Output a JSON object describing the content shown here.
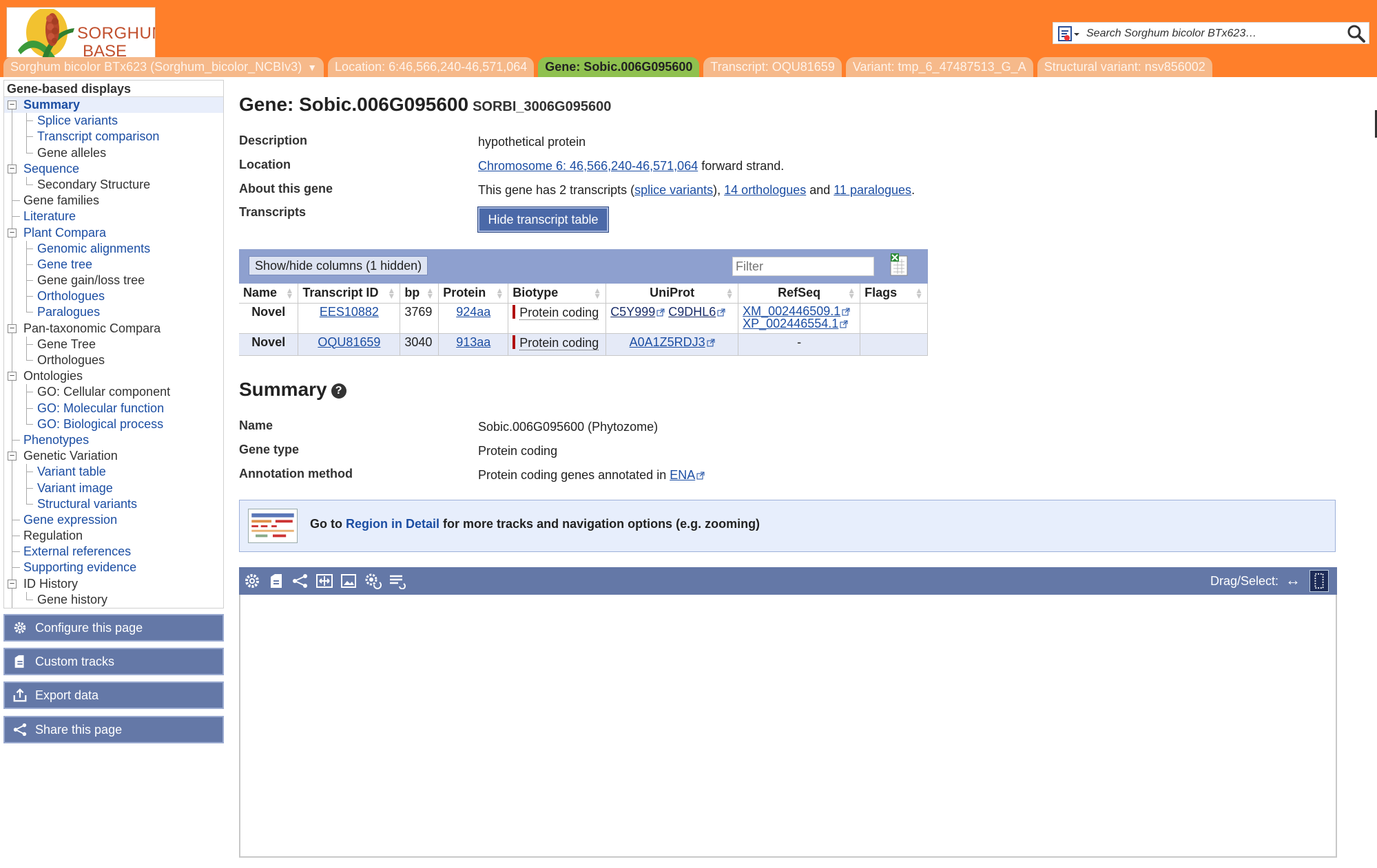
{
  "header": {
    "logo": {
      "line1": "SORGHUM",
      "line2": "BASE"
    },
    "search_placeholder": "Search Sorghum bicolor BTx623…",
    "tabs": [
      {
        "label": "Sorghum bicolor BTx623 (Sorghum_bicolor_NCBIv3)",
        "arrow": "▼"
      },
      {
        "label": "Location: 6:46,566,240-46,571,064"
      },
      {
        "label": "Gene: Sobic.006G095600",
        "active": true
      },
      {
        "label": "Transcript: OQU81659"
      },
      {
        "label": "Variant: tmp_6_47487513_G_A"
      },
      {
        "label": "Structural variant: nsv856002"
      }
    ]
  },
  "sidebar": {
    "heading": "Gene-based displays",
    "items": [
      {
        "label": "Summary",
        "level": 1,
        "box": "−",
        "link": true,
        "selected": true
      },
      {
        "label": "Splice variants",
        "level": 2,
        "link": true
      },
      {
        "label": "Transcript comparison",
        "level": 2,
        "link": true
      },
      {
        "label": "Gene alleles",
        "level": 2,
        "link": false
      },
      {
        "label": "Sequence",
        "level": 1,
        "box": "−",
        "link": true
      },
      {
        "label": "Secondary Structure",
        "level": 2,
        "link": false
      },
      {
        "label": "Gene families",
        "level": 1,
        "link": false
      },
      {
        "label": "Literature",
        "level": 1,
        "link": true
      },
      {
        "label": "Plant Compara",
        "level": 1,
        "box": "−",
        "link": true
      },
      {
        "label": "Genomic alignments",
        "level": 2,
        "link": true
      },
      {
        "label": "Gene tree",
        "level": 2,
        "link": true
      },
      {
        "label": "Gene gain/loss tree",
        "level": 2,
        "link": false
      },
      {
        "label": "Orthologues",
        "level": 2,
        "link": true
      },
      {
        "label": "Paralogues",
        "level": 2,
        "link": true
      },
      {
        "label": "Pan-taxonomic Compara",
        "level": 1,
        "box": "−",
        "link": false
      },
      {
        "label": "Gene Tree",
        "level": 2,
        "link": false
      },
      {
        "label": "Orthologues",
        "level": 2,
        "link": false
      },
      {
        "label": "Ontologies",
        "level": 1,
        "box": "−",
        "link": false
      },
      {
        "label": "GO: Cellular component",
        "level": 2,
        "link": false
      },
      {
        "label": "GO: Molecular function",
        "level": 2,
        "link": true
      },
      {
        "label": "GO: Biological process",
        "level": 2,
        "link": true
      },
      {
        "label": "Phenotypes",
        "level": 1,
        "link": true
      },
      {
        "label": "Genetic Variation",
        "level": 1,
        "box": "−",
        "link": false
      },
      {
        "label": "Variant table",
        "level": 2,
        "link": true
      },
      {
        "label": "Variant image",
        "level": 2,
        "link": true
      },
      {
        "label": "Structural variants",
        "level": 2,
        "link": true
      },
      {
        "label": "Gene expression",
        "level": 1,
        "link": true
      },
      {
        "label": "Regulation",
        "level": 1,
        "link": false
      },
      {
        "label": "External references",
        "level": 1,
        "link": true
      },
      {
        "label": "Supporting evidence",
        "level": 1,
        "link": true
      },
      {
        "label": "ID History",
        "level": 1,
        "box": "−",
        "link": false
      },
      {
        "label": "Gene history",
        "level": 2,
        "link": false
      }
    ],
    "buttons": {
      "configure": "Configure this page",
      "custom_tracks": "Custom tracks",
      "export": "Export data",
      "share": "Share this page"
    }
  },
  "main": {
    "title": "Gene: Sobic.006G095600",
    "subtitle": "SORBI_3006G095600",
    "description_label": "Description",
    "description_value": "hypothetical protein",
    "location_label": "Location",
    "location_link": "Chromosome 6: 46,566,240-46,571,064",
    "location_suffix": " forward strand.",
    "about_label": "About this gene",
    "about_prefix": "This gene has 2 transcripts (",
    "about_splice": "splice variants",
    "about_mid1": "), ",
    "about_orth": "14 orthologues",
    "about_mid2": " and ",
    "about_para": "11 paralogues",
    "about_end": ".",
    "transcripts_label": "Transcripts",
    "hide_button": "Hide transcript table"
  },
  "transcript_table": {
    "show_hide_label": "Show/hide columns (1 hidden)",
    "filter_placeholder": "Filter",
    "columns": [
      "Name",
      "Transcript ID",
      "bp",
      "Protein",
      "Biotype",
      "UniProt",
      "RefSeq",
      "Flags"
    ],
    "rows": [
      {
        "name": "Novel",
        "transcript_id": "EES10882",
        "bp": "3769",
        "protein": "924aa",
        "biotype": "Protein coding",
        "uniprot": [
          "C5Y999",
          "C9DHL6"
        ],
        "refseq": [
          "XM_002446509.1",
          "XP_002446554.1"
        ],
        "flags": ""
      },
      {
        "name": "Novel",
        "transcript_id": "OQU81659",
        "bp": "3040",
        "protein": "913aa",
        "biotype": "Protein coding",
        "uniprot": [
          "A0A1Z5RDJ3"
        ],
        "refseq": [
          "-"
        ],
        "flags": ""
      }
    ]
  },
  "summary": {
    "heading": "Summary",
    "help": "?",
    "name_label": "Name",
    "name_value": "Sobic.006G095600 (Phytozome)",
    "type_label": "Gene type",
    "type_value": "Protein coding",
    "method_label": "Annotation method",
    "method_value": "Protein coding genes annotated in ",
    "method_link": "ENA"
  },
  "region_box": {
    "prefix": "Go to ",
    "link": "Region in Detail",
    "suffix": " for more tracks and navigation options (e.g. zooming)"
  },
  "viewer": {
    "drag_label": "Drag/Select:",
    "drag_arrow": "↔",
    "icons": [
      "gear-icon",
      "add-track-icon",
      "share-icon",
      "resize-icon",
      "image-export-icon",
      "reset-config-icon",
      "reset-order-icon"
    ]
  },
  "colors": {
    "masthead": "#ff7f2a",
    "active_tab": "#8fc14f",
    "link": "#1c4ea3",
    "panel_blue": "#6478a7",
    "biotype_protein_coding": "#b01010"
  }
}
